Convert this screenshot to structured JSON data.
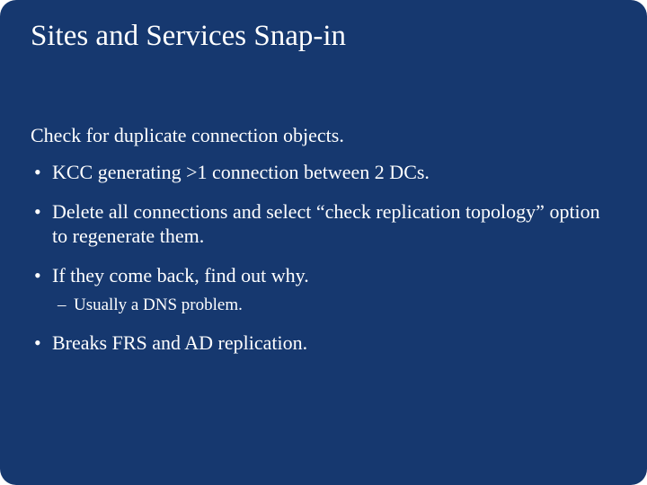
{
  "slide": {
    "title": "Sites and Services Snap-in",
    "lead": "Check for duplicate connection objects.",
    "bullets": [
      {
        "text": "KCC generating >1 connection between 2 DCs."
      },
      {
        "text": "Delete all connections and select “check replication topology” option to regenerate them."
      },
      {
        "text": "If they come back, find out why.",
        "sub": [
          {
            "text": "Usually a DNS problem."
          }
        ]
      },
      {
        "text": "Breaks FRS and AD replication."
      }
    ]
  }
}
